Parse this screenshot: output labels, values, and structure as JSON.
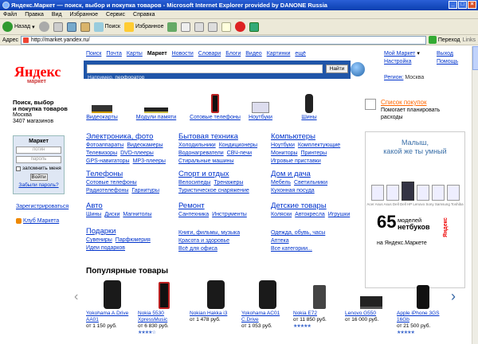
{
  "window": {
    "title": "Яндекс.Маркет — поиск, выбор и покупка товаров - Microsoft Internet Explorer provided by DANONE Russia"
  },
  "menu": [
    "Файл",
    "Правка",
    "Вид",
    "Избранное",
    "Сервис",
    "Справка"
  ],
  "toolbar": {
    "back": "Назад",
    "search": "Поиск",
    "favorites": "Избранное"
  },
  "address": {
    "label": "Адрес",
    "url": "http://market.yandex.ru/",
    "go": "Переход",
    "links": "Links"
  },
  "logo": {
    "main": "Яндекс",
    "sub": "маркет"
  },
  "nav": [
    "Поиск",
    "Почта",
    "Карты",
    "Маркет",
    "Новости",
    "Словари",
    "Блоги",
    "Видео",
    "Картинки",
    "ещё"
  ],
  "search": {
    "button": "Найти",
    "hint": "Например,",
    "hint_link": "перфоратор"
  },
  "user": {
    "market": "Мой Маркет",
    "settings": "Настройка",
    "exit": "Выход",
    "help": "Помощь",
    "region_link": "Регион:",
    "region": "Москва"
  },
  "intro": {
    "line1": "Поиск, выбор",
    "line2": "и покупка товаров",
    "city": "Москва",
    "shops": "3407 магазинов"
  },
  "login": {
    "title": "Маркет",
    "login_ph": "логин",
    "password_ph": "пароль",
    "remember": "запомнить меня",
    "submit": "Войти",
    "forgot": "Забыли пароль?"
  },
  "register": "Зарегистрироваться",
  "club": "Клуб Маркета",
  "topcats": [
    "Видеокарты",
    "Модули памяти",
    "Сотовые телефоны",
    "Ноутбуки",
    "Шины"
  ],
  "wishlist": {
    "title": "Список покупок",
    "line1": "Помогает планировать",
    "line2": "расходы"
  },
  "categories": [
    {
      "title": "Электроника, фото",
      "rows": [
        [
          "Фотоаппараты",
          "Видеокамеры"
        ],
        [
          "Телевизоры",
          "DVD-плееры"
        ],
        [
          "GPS-навигаторы",
          "MP3-плееры"
        ]
      ]
    },
    {
      "title": "Бытовая техника",
      "rows": [
        [
          "Холодильники",
          "Кондиционеры"
        ],
        [
          "Водонагреватели",
          "СВЧ-печи"
        ],
        [
          "Стиральные машины"
        ]
      ]
    },
    {
      "title": "Компьютеры",
      "rows": [
        [
          "Ноутбуки",
          "Комплектующие"
        ],
        [
          "Мониторы",
          "Принтеры"
        ],
        [
          "Игровые приставки"
        ]
      ]
    },
    {
      "title": "Телефоны",
      "rows": [
        [
          "Сотовые телефоны"
        ],
        [
          "Радиотелефоны",
          "Гарнитуры"
        ]
      ]
    },
    {
      "title": "Спорт и отдых",
      "rows": [
        [
          "Велосипеды",
          "Тренажеры"
        ],
        [
          "Туристическое снаряжение"
        ]
      ]
    },
    {
      "title": "Дом и дача",
      "rows": [
        [
          "Мебель",
          "Светильники"
        ],
        [
          "Кухонная посуда"
        ]
      ]
    },
    {
      "title": "Авто",
      "rows": [
        [
          "Шины",
          "Диски",
          "Магнитолы"
        ]
      ]
    },
    {
      "title": "Ремонт",
      "rows": [
        [
          "Сантехника",
          "Инструменты"
        ]
      ]
    },
    {
      "title": "Детские товары",
      "rows": [
        [
          "Коляски",
          "Автокресла",
          "Игрушки"
        ]
      ]
    },
    {
      "title": "Подарки",
      "rows": [
        [
          "Сувениры",
          "Парфюмерия"
        ],
        [
          "Идеи подарков"
        ]
      ]
    }
  ],
  "more_links": {
    "col2": [
      "Книги, фильмы, музыка",
      "Красота и здоровье",
      "Всё для офиса"
    ],
    "col3": [
      "Одежда, обувь, часы",
      "Аптека",
      "Все категории..."
    ]
  },
  "ad": {
    "head1": "Малыш,",
    "head2": "какой же ты умный",
    "names": "Acer Asus Asus Dell Dell HP Lenovo Sony Samsung Toshiba",
    "count": "65",
    "line1": "моделей",
    "line2": "нетбуков",
    "line3": "на Яндекс.Маркете",
    "brand": "Яндекс"
  },
  "popular": {
    "title": "Популярные товары",
    "items": [
      {
        "name": "Yokohama A.Drive AA01",
        "price": "от 1 150 руб."
      },
      {
        "name": "Nokia 5530 XpressMusic",
        "price": "от 6 830 руб.",
        "stars": "★★★★☆"
      },
      {
        "name": "Nokian Hakka i3",
        "price": "от 1 478 руб."
      },
      {
        "name": "Yokohama AC01 C.Drive",
        "price": "от 1 053 руб."
      },
      {
        "name": "Nokia E72",
        "price": "от 11 850 руб.",
        "stars": "★★★★★"
      },
      {
        "name": "Lenovo G550",
        "price": "от 16 000 руб."
      },
      {
        "name": "Apple iPhone 3GS 16Gb",
        "price": "от 21 500 руб.",
        "stars": "★★★★★"
      }
    ]
  },
  "colors": {
    "brand_red": "#ff0000",
    "search_blue": "#1f55a8",
    "link": "#0033cc",
    "title_bar": "#0a3fb0"
  }
}
